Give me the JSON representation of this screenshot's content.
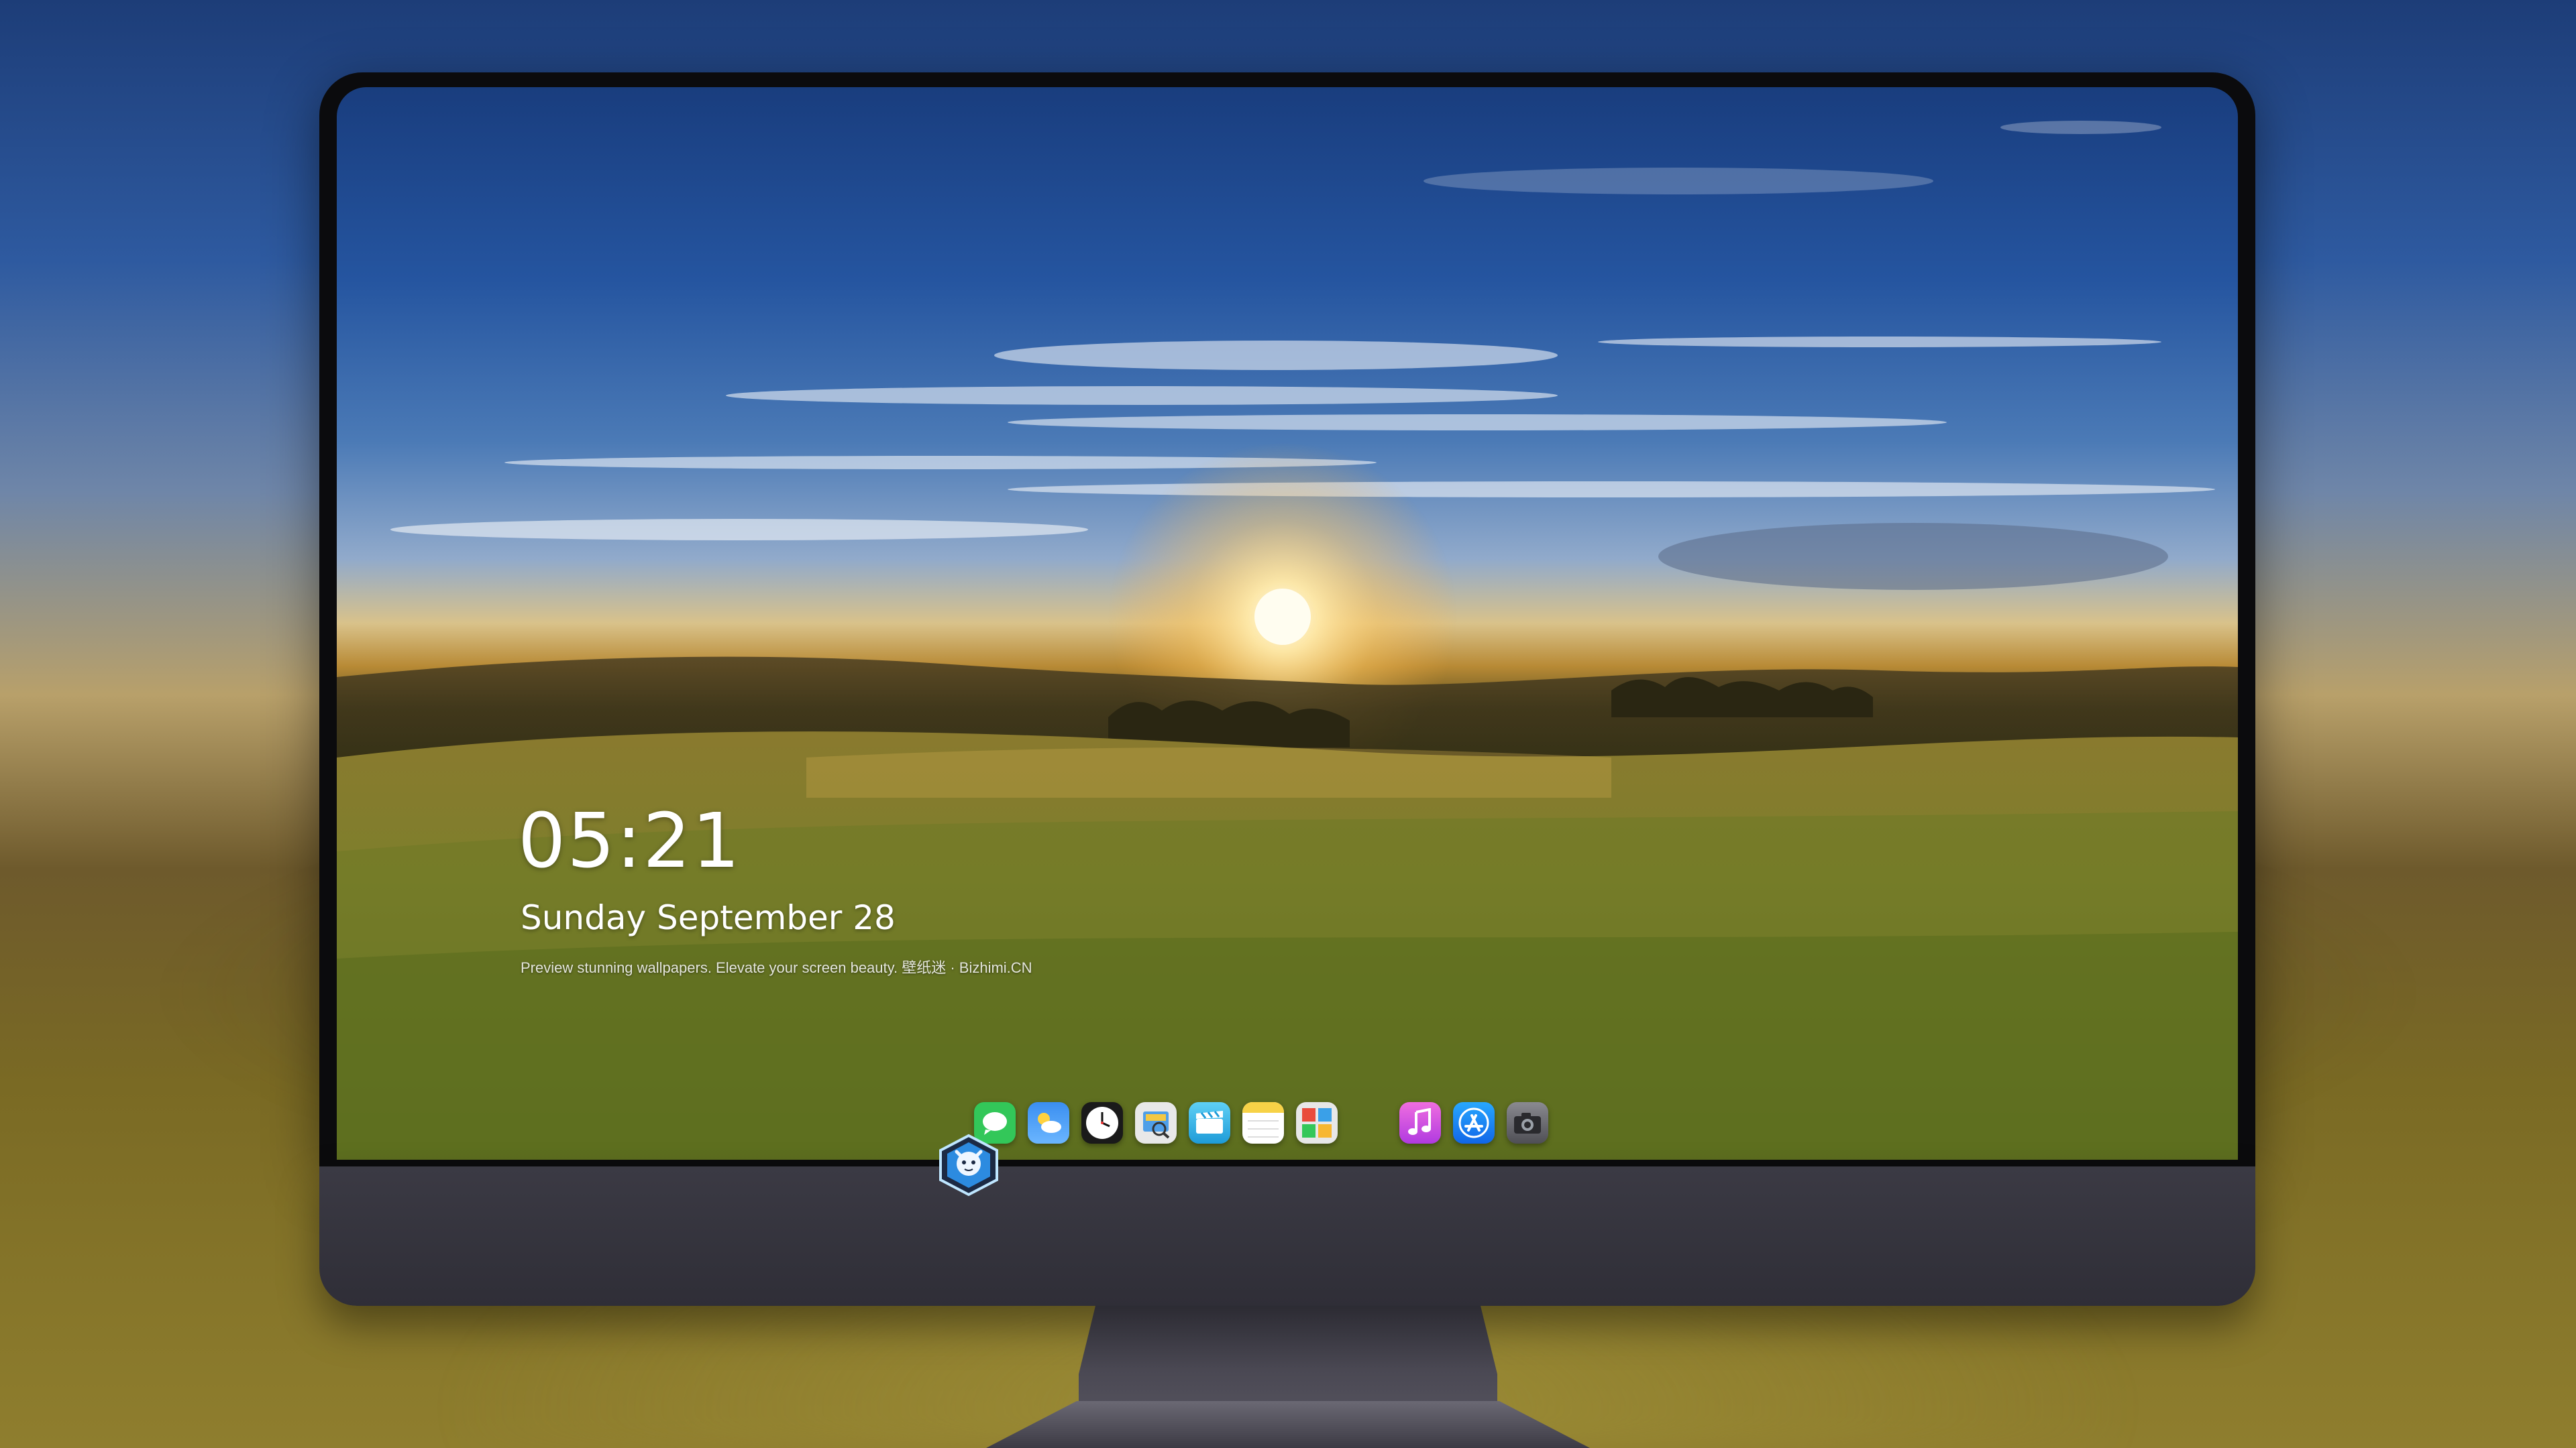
{
  "lockscreen": {
    "time": "05:21",
    "date": "Sunday September  28",
    "tagline": "Preview stunning wallpapers. Elevate your screen beauty. 壁纸迷 · Bizhimi.CN"
  },
  "dock": {
    "items": [
      {
        "name": "messages",
        "icon": "messages-icon",
        "color": "#33c759"
      },
      {
        "name": "weather",
        "icon": "weather-icon",
        "color": "#3a8ef0"
      },
      {
        "name": "clock",
        "icon": "clock-icon",
        "color": "#ffffff"
      },
      {
        "name": "preview",
        "icon": "preview-icon",
        "color": "#4f9fe8"
      },
      {
        "name": "clips",
        "icon": "clips-icon",
        "color": "#36b3e8"
      },
      {
        "name": "notes",
        "icon": "notes-icon",
        "color": "#f7d247"
      },
      {
        "name": "photo-booth",
        "icon": "photo-booth-icon",
        "color": "#e7e7e7"
      },
      {
        "name": "music",
        "icon": "music-icon",
        "color": "#e55be0"
      },
      {
        "name": "app-store",
        "icon": "app-store-icon",
        "color": "#1e8ef5"
      },
      {
        "name": "camera",
        "icon": "camera-icon",
        "color": "#6c6c70"
      }
    ]
  },
  "colors": {
    "sky_top": "#193d7e",
    "horizon_glow": "#ffd88a",
    "grass": "#6f7426",
    "bezel": "#0b0b0d",
    "chin": "#34333c"
  }
}
